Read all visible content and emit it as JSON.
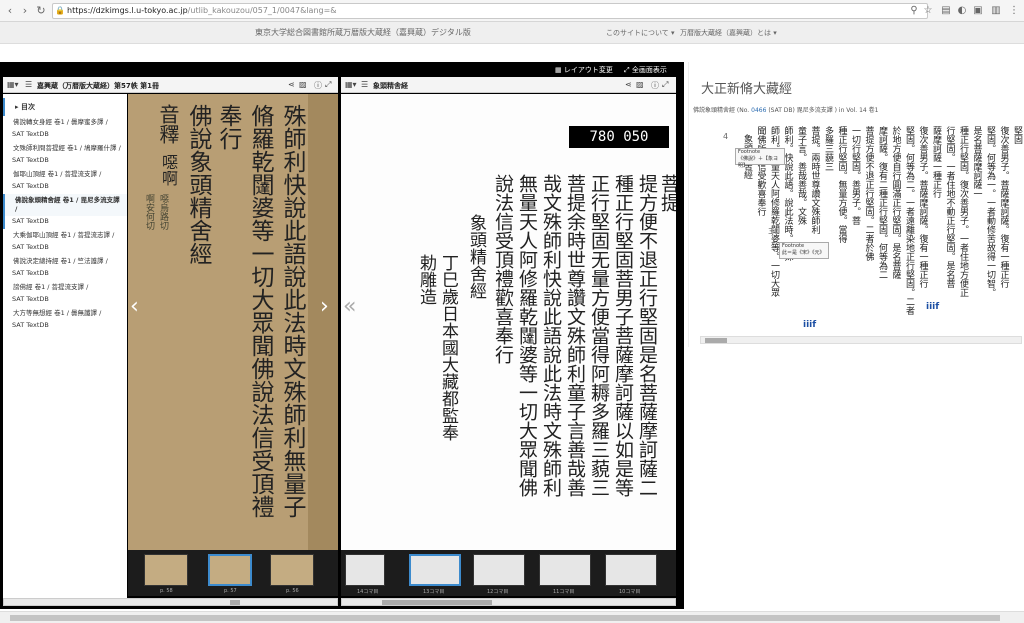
{
  "browser": {
    "url_host": "https://dzkimgs.l.u-tokyo.ac.jp",
    "url_path": "/utlib_kakouzou/057_1/0047&lang=&"
  },
  "site": {
    "title": "東京大学総合図書館所蔵万暦版大蔵経（嘉興蔵）デジタル版",
    "nav_about": "このサイトについて ▾",
    "nav_manreki": "万暦版大蔵経（嘉興蔵）とは ▾"
  },
  "viewer": {
    "layout_button": "レイアウト変更",
    "fullscreen_button": "全画面表示",
    "left_panel_title": "嘉興蔵（万暦版大蔵経）第57帙 第1冊",
    "right_panel_title": "象頭精舎経",
    "toc_heading": "目次",
    "toc": [
      {
        "label": "佛說轉女身經 卷1 / 曇摩蜜多譯 /",
        "sub": "SAT TextDB"
      },
      {
        "label": "文殊師利問菩提經 卷1 / 鳩摩羅什譯 /",
        "sub": "SAT TextDB"
      },
      {
        "label": "伽耶山頂經 卷1 / 菩提流支譯 /",
        "sub": "SAT TextDB"
      },
      {
        "label": "佛說象頭精舍經 卷1 / 毘尼多流支譯 /",
        "sub": "SAT TextDB",
        "active": true
      },
      {
        "label": "大乘伽耶山頂經 卷1 / 菩提流志譯 /",
        "sub": "SAT TextDB"
      },
      {
        "label": "佛說決定總持經 卷1 / 竺法護譯 /",
        "sub": "SAT TextDB"
      },
      {
        "label": "謗佛經 卷1 / 菩提流支譯 /",
        "sub": "SAT TextDB"
      },
      {
        "label": "大方等無想經 卷1 / 曇無讖譯 /",
        "sub": "SAT TextDB"
      }
    ],
    "thumbs_left": [
      "p. 58",
      "p. 57",
      "p. 56"
    ],
    "thumbs_right": [
      "14コマ目",
      "13コマ目",
      "12コマ目",
      "11コマ目",
      "10コマ目"
    ],
    "left_page_columns": [
      "殊師利快說此語說此法時文殊師利無量子",
      "脩羅乾闥婆等一切大眾聞佛說法信受頂禮",
      "奉行",
      "佛說象頭精舍經",
      "音釋",
      "噁啊"
    ],
    "left_small": [
      "噁烏路切",
      "啊安何切"
    ],
    "right_page_columns": [
      "菩提",
      "提方便不退正行堅固是名菩薩摩訶薩二",
      "種正行堅固菩男子菩薩摩訶薩以如是等",
      "正行堅固无量方便當得阿耨多羅三藐三",
      "菩提余時世尊讚文殊師利童子言善哉善",
      "哉文殊師利快說此語說此法時文殊師利",
      "無量天人阿修羅乾闥婆等一切大眾聞佛",
      "說法信受頂禮歡喜奉行",
      "象頭精舍經",
      "丁巳歲日本國大藏都監奉",
      "勅雕造"
    ],
    "right_counter": "780 050"
  },
  "text_panel": {
    "title": "大正新脩大藏經",
    "sub_prefix": "佛説象頭精舍經 (No. ",
    "sub_number": "0466",
    "sub_suffix": " (SAT DB) 毘尼多流支譯 ) in Vol. 14 卷1",
    "columns": [
      "堅固",
      "復次善男子。菩薩摩訶薩。復有一種正行",
      "堅固。何等為一。一者動修苦故得一切智。",
      "是名菩薩摩訶薩一",
      "種正行堅固。復次善男子。一者住地方便正",
      "行堅固。一者住地不動正行堅固。是名菩",
      "薩摩訶薩一種正行",
      "復次善男子。菩薩摩訶薩。復有一種正行",
      "堅固。何等為二。一者遠離染地正行堅固。二者",
      "於地方便自行圓滿正行堅固。是名菩薩",
      "摩訶薩。復有二種正行堅固。何等為二",
      "菩提方便不退正行堅固。二者於佛",
      "一切行堅固。善男子。菩",
      "種正行堅固。無量方便。當得",
      "多羅三藐三",
      "菩提。兩時世尊讚文殊師利",
      "童子言。善哉善哉。文殊",
      "師利。快說此語。說此法時。文殊",
      "師利。無量天人阿修羅乾闥婆等。一切大眾",
      "聞佛所說信受歡喜奉行",
      "象頭精舍經"
    ],
    "num_4": "4",
    "num_3": "3",
    "footnote1_label": "Footnote",
    "footnote1_text": "《佛說》＋【象ヨ明】",
    "footnote2_label": "Footnote",
    "footnote2_text": "此＝是《宋》《元》",
    "iiif": "iiif"
  }
}
